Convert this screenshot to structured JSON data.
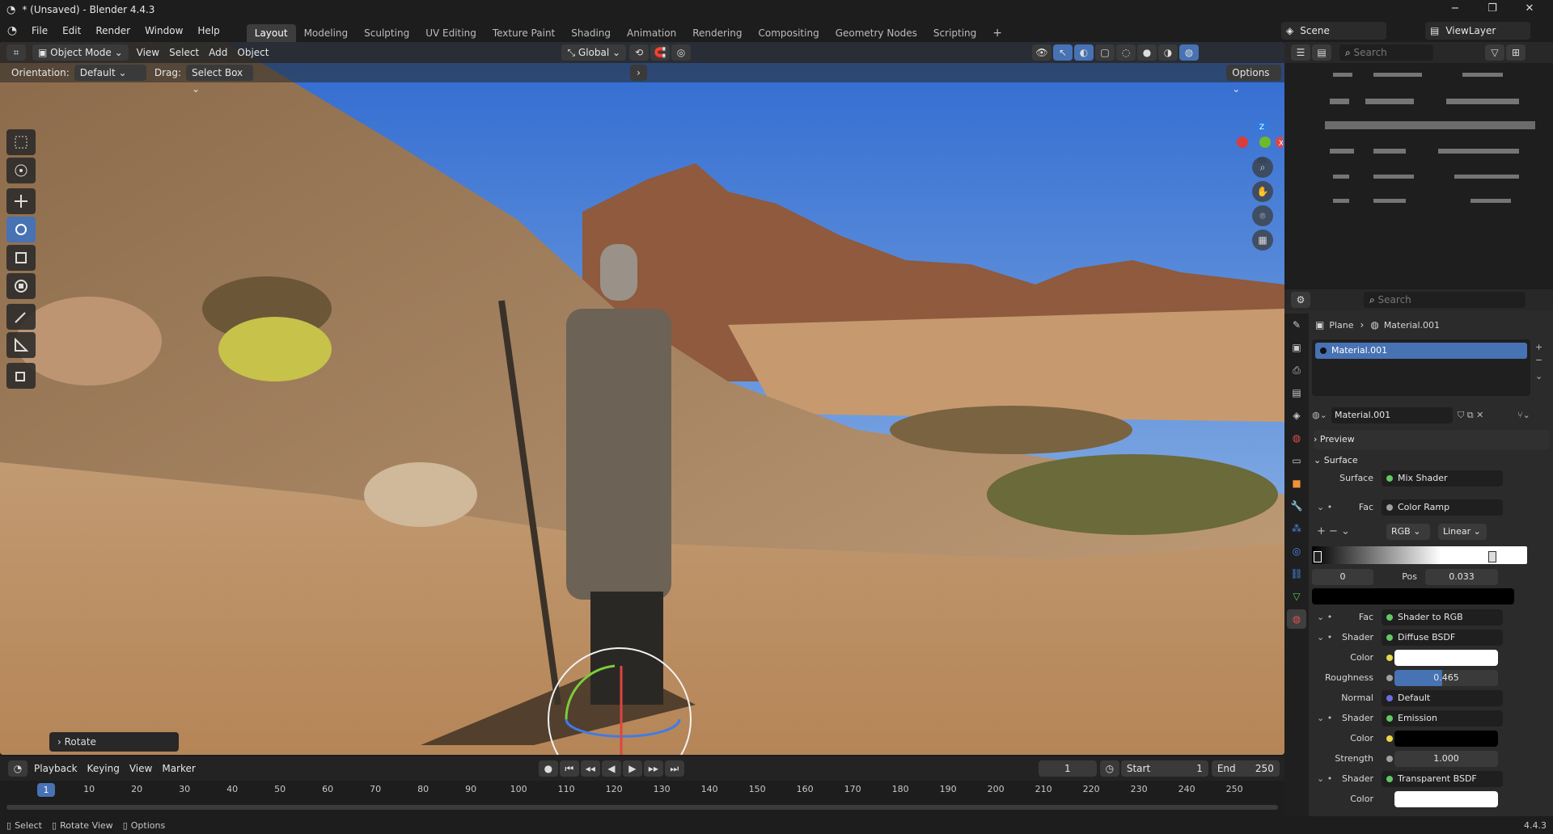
{
  "titlebar": {
    "title": "* (Unsaved) - Blender 4.4.3",
    "minimize": "−",
    "maximize": "❐",
    "close": "✕"
  },
  "menu": [
    "File",
    "Edit",
    "Render",
    "Window",
    "Help"
  ],
  "workspaces": [
    "Layout",
    "Modeling",
    "Sculpting",
    "UV Editing",
    "Texture Paint",
    "Shading",
    "Animation",
    "Rendering",
    "Compositing",
    "Geometry Nodes",
    "Scripting",
    "+"
  ],
  "scene": {
    "scene_name": "Scene",
    "viewlayer": "ViewLayer"
  },
  "viewport": {
    "mode": "Object Mode",
    "menus": [
      "View",
      "Select",
      "Add",
      "Object"
    ],
    "transform_orientation": "Global",
    "orientation_label": "Orientation:",
    "orientation_value": "Default",
    "drag_label": "Drag:",
    "drag_value": "Select Box",
    "options": "Options",
    "last_op": "Rotate",
    "gizmo": {
      "z": "Z",
      "x": "X"
    }
  },
  "timeline": {
    "menus": [
      "Playback",
      "Keying",
      "View",
      "Marker"
    ],
    "current_frame": "1",
    "start_label": "Start",
    "start": "1",
    "end_label": "End",
    "end": "250",
    "ticks": [
      "1",
      "10",
      "20",
      "30",
      "40",
      "50",
      "60",
      "70",
      "80",
      "90",
      "100",
      "110",
      "120",
      "130",
      "140",
      "150",
      "160",
      "170",
      "180",
      "190",
      "200",
      "210",
      "220",
      "230",
      "240",
      "250"
    ]
  },
  "statusbar": {
    "select": "Select",
    "rotate_view": "Rotate View",
    "options": "Options",
    "version": "4.4.3"
  },
  "outliner": {
    "search_placeholder": "Search"
  },
  "properties": {
    "search_placeholder": "Search",
    "breadcrumb_object": "Plane",
    "breadcrumb_material": "Material.001",
    "slot": "Material.001",
    "material_name": "Material.001",
    "preview": "Preview",
    "surface_panel": "Surface",
    "rows": {
      "surface_label": "Surface",
      "surface_value": "Mix Shader",
      "fac_label": "Fac",
      "fac_value": "Color Ramp",
      "ramp_mode": "RGB",
      "ramp_interp": "Linear",
      "ramp_index": "0",
      "pos_label": "Pos",
      "pos_value": "0.033",
      "fac2_label": "Fac",
      "fac2_value": "Shader to RGB",
      "shader_label": "Shader",
      "shader_value": "Diffuse BSDF",
      "color_label": "Color",
      "roughness_label": "Roughness",
      "roughness_value": "0.465",
      "normal_label": "Normal",
      "normal_value": "Default",
      "shader2_label": "Shader",
      "shader2_value": "Emission",
      "color2_label": "Color",
      "strength_label": "Strength",
      "strength_value": "1.000",
      "shader3_label": "Shader",
      "shader3_value": "Transparent BSDF",
      "color3_label": "Color"
    }
  },
  "colors": {
    "accent": "#4772b3",
    "panel": "#2b2b2b",
    "header": "#1d1d1d"
  },
  "icons": [
    "blender-logo-icon",
    "select-box-icon",
    "cursor-icon",
    "move-icon",
    "rotate-icon",
    "scale-icon",
    "transform-icon",
    "annotate-icon",
    "measure-icon",
    "add-cube-icon",
    "zoom-icon",
    "hand-icon",
    "camera-icon",
    "grid-icon"
  ]
}
